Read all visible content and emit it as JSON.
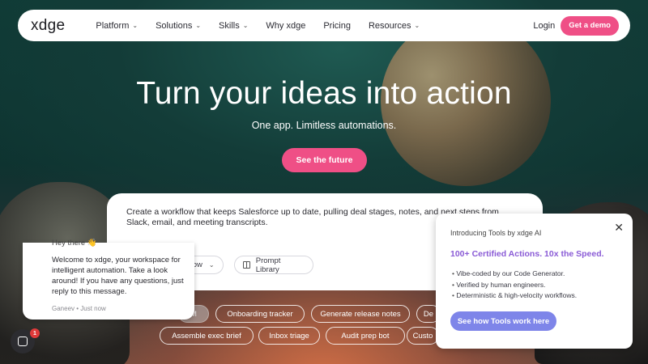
{
  "nav": {
    "logo": "xdge",
    "links": [
      {
        "label": "Platform",
        "dropdown": true
      },
      {
        "label": "Solutions",
        "dropdown": true
      },
      {
        "label": "Skills",
        "dropdown": true
      },
      {
        "label": "Why xdge",
        "dropdown": false
      },
      {
        "label": "Pricing",
        "dropdown": false
      },
      {
        "label": "Resources",
        "dropdown": true
      }
    ],
    "login": "Login",
    "demo": "Get a demo"
  },
  "hero": {
    "title": "Turn your ideas into action",
    "subtitle": "One app. Limitless automations.",
    "cta": "See the future"
  },
  "prompt": {
    "text": "Create a workflow that keeps Salesforce up to date, pulling deal stages, notes, and next steps from Slack, email, and meeting transcripts.",
    "workflow_btn": "flow",
    "library_btn": "Prompt Library"
  },
  "chips": {
    "row1": [
      "M",
      "Onboarding tracker",
      "Generate release notes",
      "De"
    ],
    "row2": [
      "Assemble exec brief",
      "Inbox triage",
      "Audit prep bot",
      "Custo"
    ]
  },
  "chat": {
    "greeting": "Hey there 👋",
    "message": "Welcome to xdge, your workspace for intelligent automation. Take a look around! If you have any questions, just reply to this message.",
    "meta": "Ganeev • Just now",
    "badge": "1"
  },
  "tools_popup": {
    "intro": "Introducing Tools by xdge AI",
    "title": "100+ Certified Actions. 10x the Speed.",
    "bullets": [
      "Vibe-coded by our Code Generator.",
      "Verified by human engineers.",
      "Deterministic & high-velocity workflows."
    ],
    "button": "See how Tools work here"
  },
  "colors": {
    "accent_pink": "#ef4f86",
    "tools_purple": "#7e85e9"
  }
}
